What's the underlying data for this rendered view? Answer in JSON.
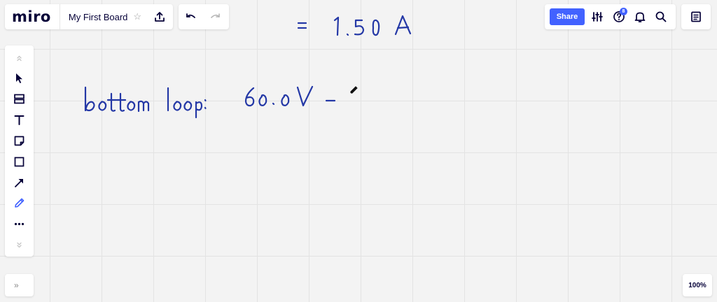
{
  "app": {
    "logo": "miro",
    "board_title": "My First Board"
  },
  "toolbar_top": {
    "share_label": "Share",
    "help_badge_count": "8"
  },
  "canvas": {
    "line1": "= 1.50 A",
    "line2_label": "bottom loop:",
    "line2_expr": "60.0V -",
    "ink_color": "#2438a6"
  },
  "zoom": {
    "level": "100%"
  },
  "colors": {
    "accent": "#4262ff",
    "toolbar_active": "#4262ff"
  },
  "icons": [
    "star-icon",
    "export-icon",
    "undo-icon",
    "redo-icon",
    "settings-sliders-icon",
    "help-icon",
    "bell-icon",
    "search-icon",
    "notes-icon",
    "chevron-up-icon",
    "select-cursor-icon",
    "frame-icon",
    "text-icon",
    "sticky-note-icon",
    "rectangle-icon",
    "arrow-line-icon",
    "pen-icon",
    "more-icon",
    "chevron-down-icon",
    "collapse-icon"
  ]
}
